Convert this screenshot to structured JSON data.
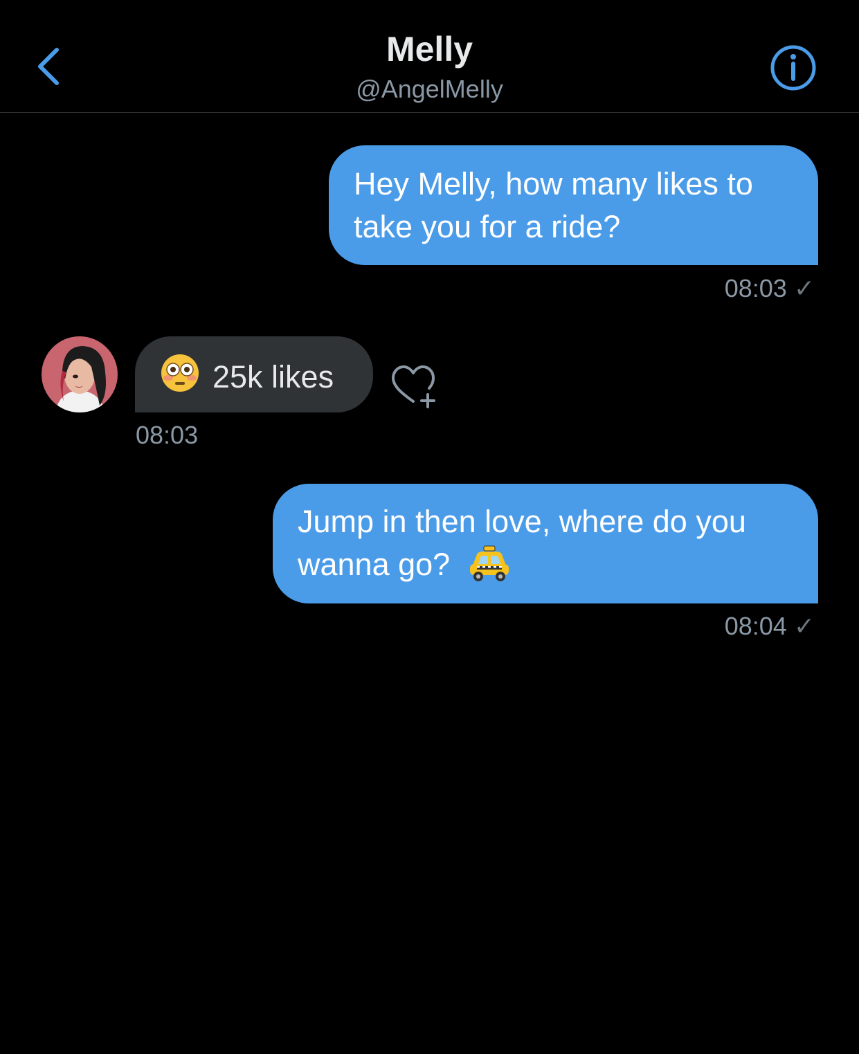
{
  "header": {
    "title": "Melly",
    "handle": "@AngelMelly",
    "back_icon": "chevron-left-icon",
    "info_icon": "info-icon"
  },
  "colors": {
    "accent": "#4b9ce8",
    "background": "#000000",
    "incoming_bubble": "#2f3336",
    "muted_text": "#8b98a5"
  },
  "messages": [
    {
      "direction": "outgoing",
      "line1": "Hey Melly, how many likes to",
      "line2": "take you for a ride?",
      "time": "08:03",
      "status_icon": "check-icon"
    },
    {
      "direction": "incoming",
      "emoji_icon": "flushed-face-emoji",
      "text": "25k likes",
      "time": "08:03",
      "reaction_icon": "add-reaction-heart-icon"
    },
    {
      "direction": "outgoing",
      "line1": "Jump in then love, where do you",
      "line2": "wanna go?",
      "trailing_emoji_icon": "taxi-emoji",
      "time": "08:04",
      "status_icon": "check-icon"
    }
  ]
}
